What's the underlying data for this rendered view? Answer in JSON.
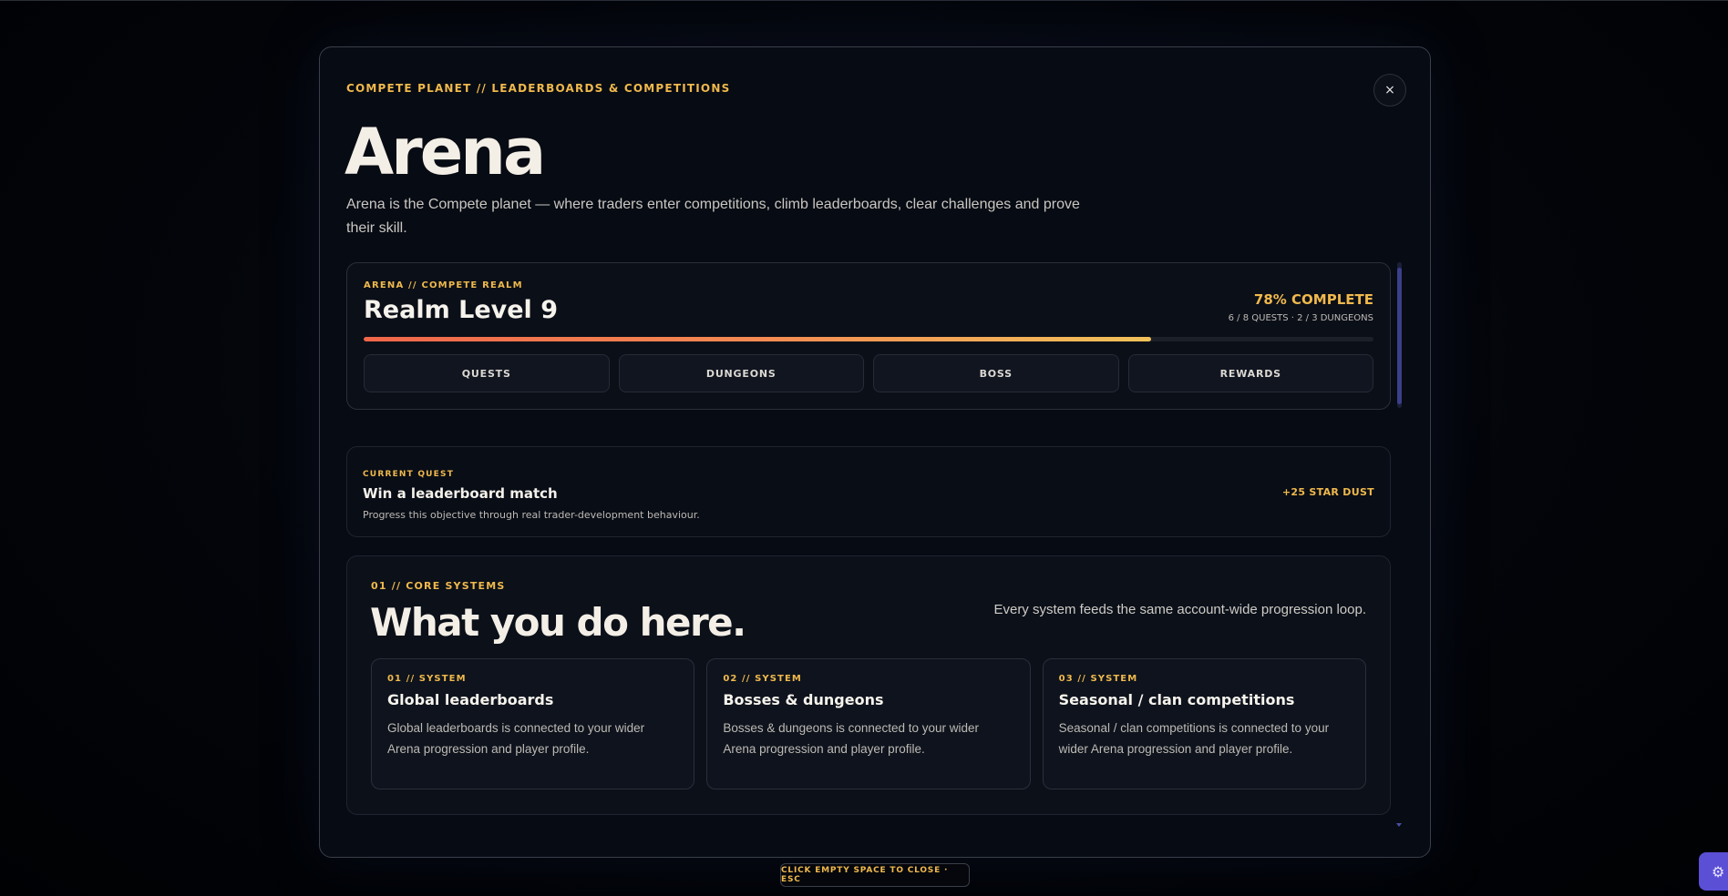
{
  "modal": {
    "kicker": "COMPETE PLANET // LEADERBOARDS & COMPETITIONS",
    "close_label": "×",
    "title": "Arena",
    "description": "Arena is the Compete planet — where traders enter competitions, climb leaderboards, clear challenges and prove their skill."
  },
  "realm": {
    "kicker": "ARENA // COMPETE REALM",
    "title": "Realm Level 9",
    "percent_label": "78% COMPLETE",
    "progress": 0.78,
    "sub": "6 / 8 QUESTS · 2 / 3 DUNGEONS",
    "tabs": [
      "QUESTS",
      "DUNGEONS",
      "BOSS",
      "REWARDS"
    ]
  },
  "quest": {
    "kicker": "CURRENT QUEST",
    "title": "Win a leaderboard match",
    "description": "Progress this objective through real trader-development behaviour.",
    "reward": "+25 STAR DUST"
  },
  "core": {
    "kicker": "01 // CORE SYSTEMS",
    "title": "What you do here.",
    "tagline": "Every system feeds the same account-wide progression loop.",
    "systems": [
      {
        "kicker": "01 // SYSTEM",
        "title": "Global leaderboards",
        "description": "Global leaderboards is connected to your wider Arena progression and player profile."
      },
      {
        "kicker": "02 // SYSTEM",
        "title": "Bosses & dungeons",
        "description": "Bosses & dungeons is connected to your wider Arena progression and player profile."
      },
      {
        "kicker": "03 // SYSTEM",
        "title": "Seasonal / clan competitions",
        "description": "Seasonal / clan competitions is connected to your wider Arena progression and player profile."
      }
    ]
  },
  "footer": {
    "hint": "CLICK EMPTY SPACE TO CLOSE · ESC"
  },
  "icons": {
    "close": "close-icon",
    "settings": "gear-icon"
  },
  "colors": {
    "accent": "#f0b94c",
    "progress_start": "#f0664a",
    "progress_end": "#f2c25a",
    "settings_button": "#5b4fd6"
  }
}
